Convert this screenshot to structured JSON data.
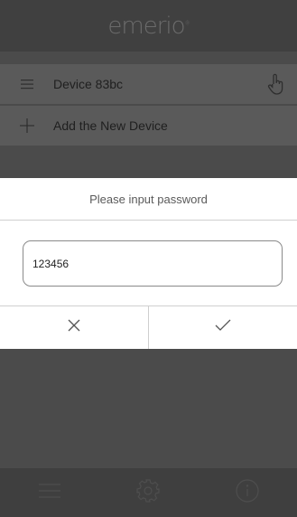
{
  "header": {
    "logo_text": "emerio"
  },
  "devices": [
    {
      "label": "Device 83bc",
      "icon": "menu-icon"
    },
    {
      "label": "Add the New Device",
      "icon": "plus-icon"
    }
  ],
  "dialog": {
    "title": "Please input password",
    "password_value": "123456",
    "cancel_icon": "close-icon",
    "confirm_icon": "check-icon"
  },
  "footer": {
    "items": [
      "list-icon",
      "gear-icon",
      "info-icon"
    ]
  },
  "colors": {
    "background": "#4b4b4b",
    "header": "#404040",
    "row": "#5a5a5a",
    "dialog": "#ffffff",
    "footer": "#3f3f3f"
  }
}
